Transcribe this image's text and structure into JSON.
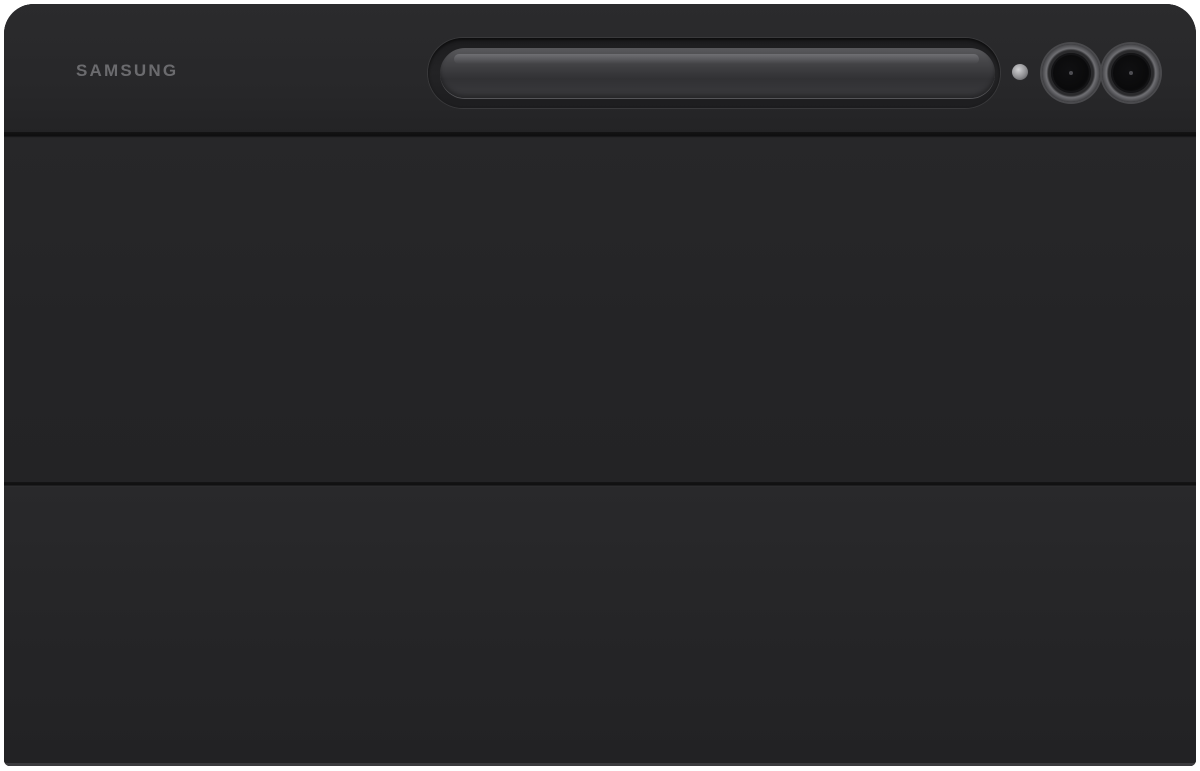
{
  "product": {
    "brand_logo": "SAMSUNG"
  },
  "colors": {
    "case_body": "#1f1f20",
    "logo_text": "#6b6b6e",
    "s_pen": "#454548"
  },
  "icons": {
    "s_pen": "s-pen-stylus-icon",
    "flash": "camera-flash-icon",
    "cameras": [
      "rear-camera-lens-icon",
      "rear-camera-lens-icon"
    ]
  }
}
